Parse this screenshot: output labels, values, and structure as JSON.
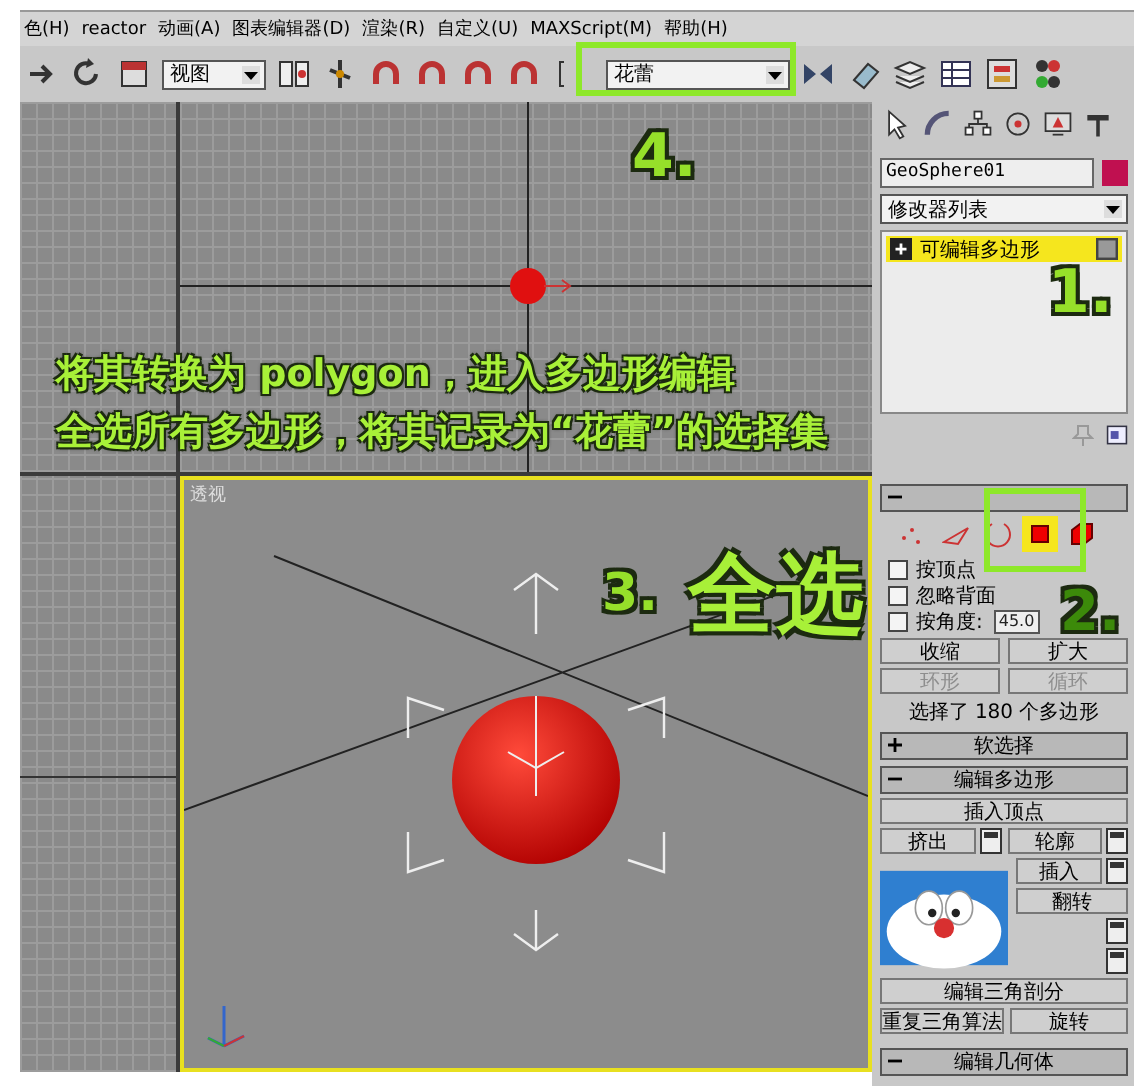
{
  "menu_bar": {
    "items": [
      "色(H)",
      "reactor",
      "动画(A)",
      "图表编辑器(D)",
      "渲染(R)",
      "自定义(U)",
      "MAXScript(M)",
      "帮助(H)"
    ]
  },
  "toolbar": {
    "view_dropdown": {
      "value": "视图"
    },
    "selection_set_dropdown": {
      "value": "花蕾"
    }
  },
  "viewports": [
    {
      "kind": "grid",
      "active": false
    },
    {
      "kind": "top",
      "active": false
    },
    {
      "kind": "grid",
      "active": false
    },
    {
      "kind": "perspective",
      "label": "透视",
      "active": true
    }
  ],
  "command_panel": {
    "object_name": "GeoSphere01",
    "modifier_list": "修改器列表",
    "modifier_stack": [
      {
        "label": "可编辑多边形",
        "selected": true
      }
    ],
    "selection_rollout": {
      "expanded": true,
      "levels": [
        {
          "kind": "vertex",
          "selected": false
        },
        {
          "kind": "edge",
          "selected": false
        },
        {
          "kind": "border",
          "selected": false
        },
        {
          "kind": "polygon",
          "selected": true
        },
        {
          "kind": "element",
          "selected": false
        }
      ],
      "options": [
        {
          "label": "按顶点",
          "checked": false
        },
        {
          "label": "忽略背面",
          "checked": false
        },
        {
          "label": "按角度:",
          "checked": false,
          "value": "45.0"
        }
      ],
      "button_rows": [
        [
          {
            "label": "收缩",
            "disabled": false
          },
          {
            "label": "扩大",
            "disabled": false
          }
        ],
        [
          {
            "label": "环形",
            "disabled": true
          },
          {
            "label": "循环",
            "disabled": true
          }
        ]
      ],
      "status": "选择了 180 个多边形"
    },
    "rollouts": [
      {
        "title": "软选择",
        "expanded": false
      },
      {
        "title": "编辑多边形",
        "expanded": true
      }
    ],
    "edit_rows": [
      [
        {
          "kind": "wide-button",
          "label": "插入顶点"
        }
      ],
      [
        {
          "kind": "button-with-settings",
          "label": "挤出"
        },
        {
          "kind": "button-with-settings",
          "label": "轮廓"
        }
      ],
      [
        {
          "kind": "button-with-settings",
          "label": "插入"
        }
      ],
      [
        {
          "kind": "button",
          "label": "翻转"
        }
      ],
      [
        {
          "kind": "settings"
        }
      ],
      [
        {
          "kind": "settings"
        }
      ],
      [
        {
          "kind": "wide-button",
          "label": "编辑三角剖分"
        }
      ],
      [
        {
          "kind": "button",
          "label": "重复三角算法"
        },
        {
          "kind": "button",
          "label": "旋转"
        }
      ]
    ],
    "last_rollout": {
      "title": "编辑几何体",
      "expanded": true
    }
  },
  "annotations": {
    "captions": [
      "将其转换为 polygon，进入多边形编辑",
      "全选所有多边形，将其记录为“花蕾”的选择集"
    ],
    "step_marks": [
      "4.",
      "1.",
      "3.",
      "2."
    ],
    "handwriting": "全选"
  }
}
